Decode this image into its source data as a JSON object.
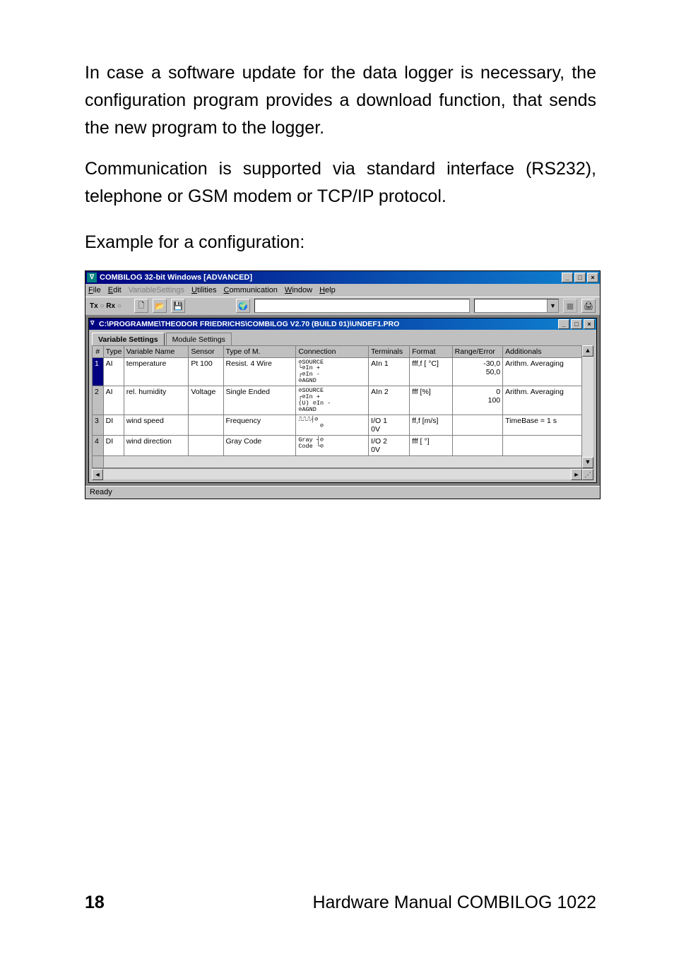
{
  "paragraphs": {
    "p1": "In case a software update for the data logger is necessary, the configuration program provides a download function, that sends the new program to the logger.",
    "p2": "Communication is supported via standard interface (RS232), telephone or GSM modem or TCP/IP protocol.",
    "p3": "Example for a configuration:"
  },
  "footer": {
    "page": "18",
    "doc": "Hardware Manual COMBILOG 1022"
  },
  "outer_window": {
    "title": "COMBILOG 32-bit Windows  [ADVANCED]",
    "menus": {
      "file": "File",
      "edit": "Edit",
      "varset": "VariableSettings",
      "utilities": "Utilities",
      "communication": "Communication",
      "window": "Window",
      "help": "Help"
    },
    "toolbar": {
      "txrx": "Tx ○ Rx ○"
    },
    "status": "Ready"
  },
  "child_window": {
    "title": "C:\\PROGRAMME\\THEODOR FRIEDRICHS\\COMBILOG V2.70 (BUILD 01)\\UNDEF1.PRO",
    "tabs": {
      "varset": "Variable Settings",
      "modset": "Module Settings"
    }
  },
  "grid": {
    "headers": {
      "num": "#",
      "type": "Type",
      "name": "Variable Name",
      "sensor": "Sensor",
      "typem": "Type of M.",
      "conn": "Connection",
      "term": "Terminals",
      "fmt": "Format",
      "re": "Range/Error",
      "add": "Additionals"
    },
    "rows": [
      {
        "num": "1",
        "type": "AI",
        "name": "temperature",
        "sensor": "Pt 100",
        "typem": "Resist. 4 Wire",
        "conn": "⊘SOURCE\n└⊘In +\n┌⊘In -\n⊘AGND",
        "term": "AIn 1",
        "fmt": "fff,f [ °C]",
        "re": "-30,0\n50,0",
        "add": "Arithm. Averaging"
      },
      {
        "num": "2",
        "type": "AI",
        "name": "rel. humidity",
        "sensor": "Voltage",
        "typem": "Single Ended",
        "conn": "⊘SOURCE\n┌⊘In +\n(U) ⊘In -\n⊘AGND",
        "term": "AIn 2",
        "fmt": "fff [%]",
        "re": "0\n100",
        "add": "Arithm. Averaging"
      },
      {
        "num": "3",
        "type": "DI",
        "name": "wind speed",
        "sensor": "",
        "typem": "Frequency",
        "conn": "⎍⎍⎍┤⊘\n      ⊘",
        "term": "I/O 1\n0V",
        "fmt": "ff,f [m/s]",
        "re": "",
        "add": "TimeBase = 1 s"
      },
      {
        "num": "4",
        "type": "DI",
        "name": "wind direction",
        "sensor": "",
        "typem": "Gray Code",
        "conn": "Gray ┤⊘\nCode └⊘",
        "term": "I/O 2\n0V",
        "fmt": "fff [ °]",
        "re": "",
        "add": ""
      }
    ]
  }
}
